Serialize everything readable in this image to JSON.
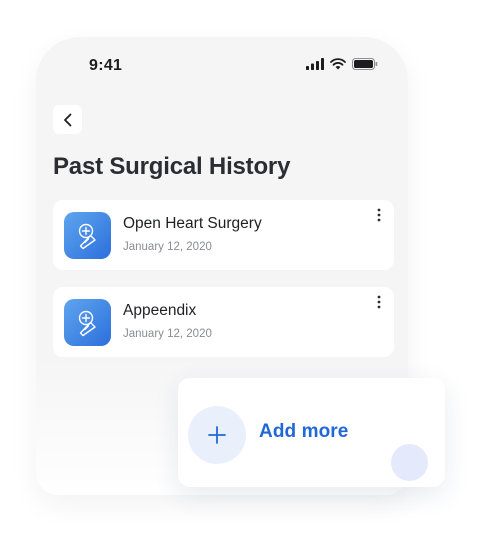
{
  "status_bar": {
    "time": "9:41"
  },
  "header": {
    "title": "Past Surgical History"
  },
  "surgeries": [
    {
      "name": "Open Heart Surgery",
      "date": "January 12, 2020",
      "icon": "scalpel-icon"
    },
    {
      "name": "Appeendix",
      "date": "January 12, 2020",
      "icon": "scalpel-icon"
    }
  ],
  "add_more": {
    "label": "Add more"
  },
  "colors": {
    "accent": "#2168d6",
    "icon_gradient_start": "#5fa5ee",
    "icon_gradient_end": "#2b6fdc",
    "screen_bg": "#f5f5f6"
  }
}
